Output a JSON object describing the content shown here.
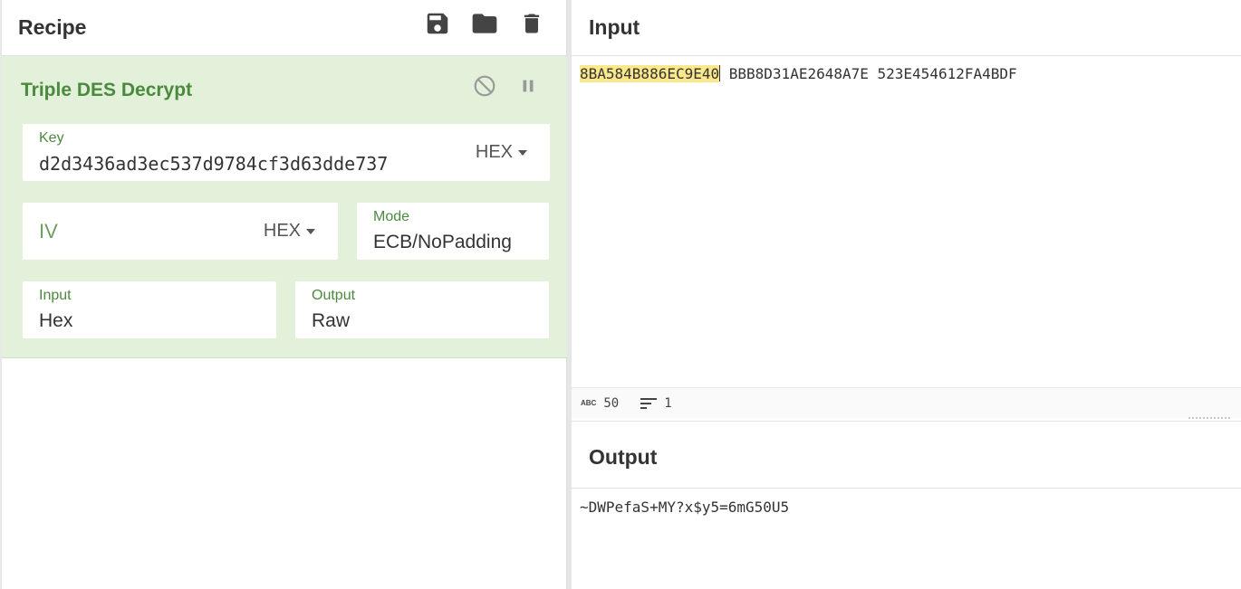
{
  "recipe": {
    "title": "Recipe",
    "icons": [
      "save-icon",
      "folder-icon",
      "trash-icon"
    ]
  },
  "operation": {
    "title": "Triple DES Decrypt",
    "icons": [
      "disable-icon",
      "pause-icon"
    ],
    "key": {
      "label": "Key",
      "value": "d2d3436ad3ec537d9784cf3d63dde737",
      "format": "HEX"
    },
    "iv": {
      "placeholder": "IV",
      "format": "HEX"
    },
    "mode": {
      "label": "Mode",
      "value": "ECB/NoPadding"
    },
    "input": {
      "label": "Input",
      "value": "Hex"
    },
    "output": {
      "label": "Output",
      "value": "Raw"
    }
  },
  "input_pane": {
    "title": "Input",
    "highlighted": "8BA584B886EC9E40",
    "rest": " BBB8D31AE2648A7E 523E454612FA4BDF",
    "status": {
      "chars": "50",
      "lines": "1"
    }
  },
  "output_pane": {
    "title": "Output",
    "text": "~DWPefaS+MY?x$y5=6mG50U5"
  },
  "colors": {
    "accent_green": "#4a8a3e",
    "op_bg": "#e3f0da",
    "highlight": "#fbe88b"
  }
}
